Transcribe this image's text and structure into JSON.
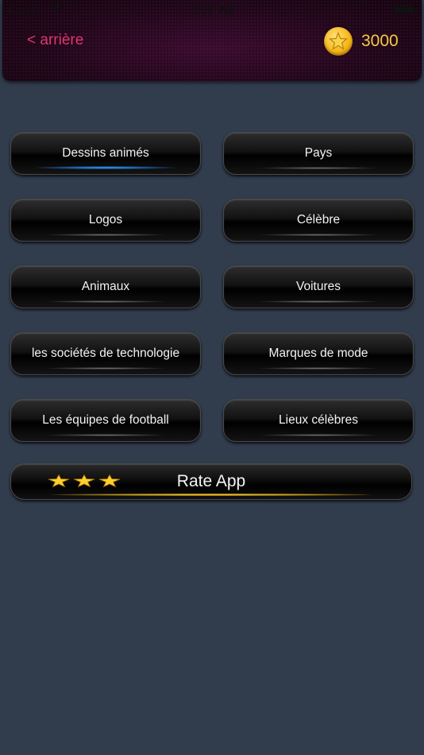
{
  "status_bar": {
    "carrier": "Carrier",
    "time": "7:59 PM"
  },
  "header": {
    "back_label": "< arrière",
    "coins": "3000"
  },
  "categories": [
    {
      "label": "Dessins animés",
      "active": true
    },
    {
      "label": "Pays",
      "active": false
    },
    {
      "label": "Logos",
      "active": false
    },
    {
      "label": "Célèbre",
      "active": false
    },
    {
      "label": "Animaux",
      "active": false
    },
    {
      "label": "Voitures",
      "active": false
    },
    {
      "label": "les sociétés de technologie",
      "active": false
    },
    {
      "label": "Marques de mode",
      "active": false
    },
    {
      "label": "Les équipes de football",
      "active": false
    },
    {
      "label": "Lieux célèbres",
      "active": false
    }
  ],
  "rate": {
    "label": "Rate App",
    "stars": 3
  },
  "colors": {
    "background": "#313c4d",
    "back_link": "#e0356e",
    "coin_text": "#f6c945",
    "active_glow": "#39a9ff",
    "rate_glow": "#ffd02a"
  },
  "icons": {
    "coin": "coin-star-icon",
    "wifi": "wifi-icon",
    "battery": "battery-icon",
    "rating_star": "star-icon"
  }
}
